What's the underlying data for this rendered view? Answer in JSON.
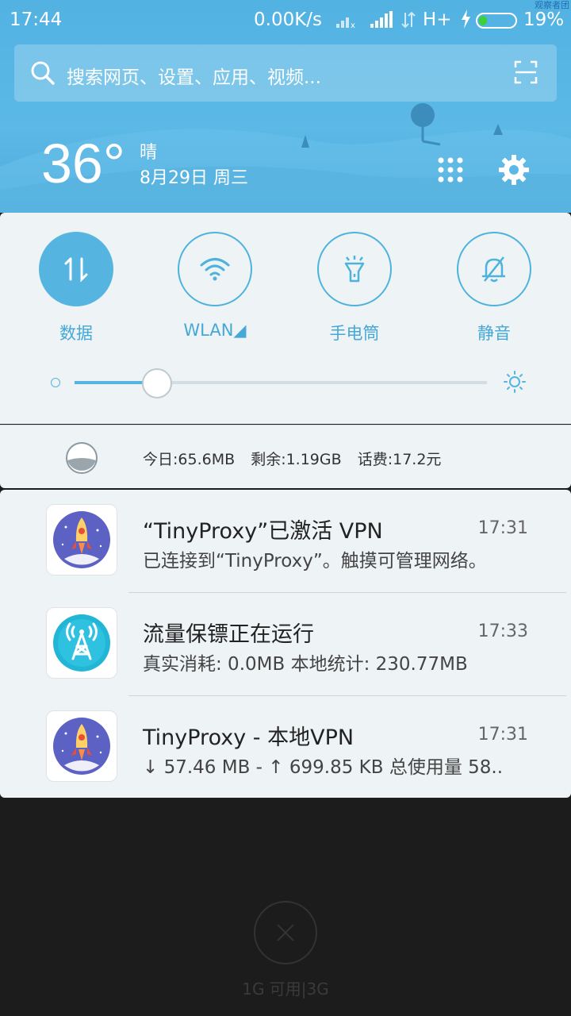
{
  "status_bar": {
    "time": "17:44",
    "speed": "0.00K/s",
    "network": "H+",
    "battery_pct": "19%",
    "corner_text": "观察者团"
  },
  "search": {
    "placeholder": "搜索网页、设置、应用、视频..."
  },
  "weather": {
    "temperature": "36°",
    "condition": "晴",
    "date": "8月29日 周三"
  },
  "toggles": [
    {
      "label": "数据",
      "icon": "mobile-data-icon",
      "on": true
    },
    {
      "label": "WLAN◢",
      "icon": "wifi-icon",
      "on": false
    },
    {
      "label": "手电筒",
      "icon": "flashlight-icon",
      "on": false
    },
    {
      "label": "静音",
      "icon": "bell-mute-icon",
      "on": false
    }
  ],
  "brightness": {
    "level": 0.2
  },
  "data_usage": {
    "today": "今日:65.6MB",
    "remaining": "剩余:1.19GB",
    "balance": "话费:17.2元"
  },
  "notifications": [
    {
      "title": "“TinyProxy”已激活 VPN",
      "time": "17:31",
      "body": "已连接到“TinyProxy”。触摸可管理网络。",
      "icon": "rocket-icon"
    },
    {
      "title": "流量保镖正在运行",
      "time": "17:33",
      "body": "真实消耗: 0.0MB   本地统计: 230.77MB",
      "icon": "antenna-icon"
    },
    {
      "title": "TinyProxy - 本地VPN",
      "time": "17:31",
      "body": "↓ 57.46 MB - ↑ 699.85 KB 总使用量 58..",
      "icon": "rocket-icon"
    }
  ],
  "memory": "1G 可用|3G",
  "colors": {
    "accent": "#55b5e0",
    "header": "#5cb9e6",
    "panel": "#eef3f5"
  }
}
